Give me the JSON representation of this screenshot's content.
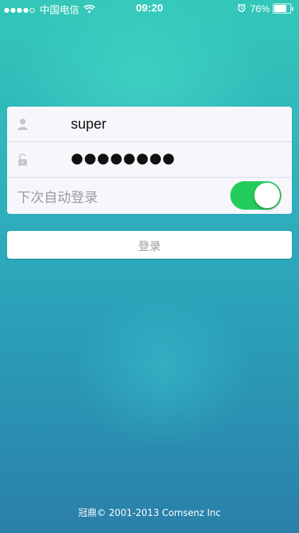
{
  "status_bar": {
    "signal_bars": 5,
    "signal_filled": 4,
    "carrier": "中国电信",
    "wifi_icon": "wifi-icon",
    "time": "09:20",
    "alarm_icon": "alarm-clock-icon",
    "battery_percent_text": "76%",
    "battery_level": 0.76
  },
  "login_form": {
    "username_icon": "user-icon",
    "username_value": "super",
    "password_icon": "lock-icon",
    "password_masked": "●●●●●●●●",
    "remember_label": "下次自动登录",
    "remember_enabled": true,
    "toggle_color": "#24cc5c"
  },
  "login_button": {
    "label": "登录"
  },
  "footer": {
    "copyright": "冠鼎© 2001-2013 Comsenz Inc"
  }
}
